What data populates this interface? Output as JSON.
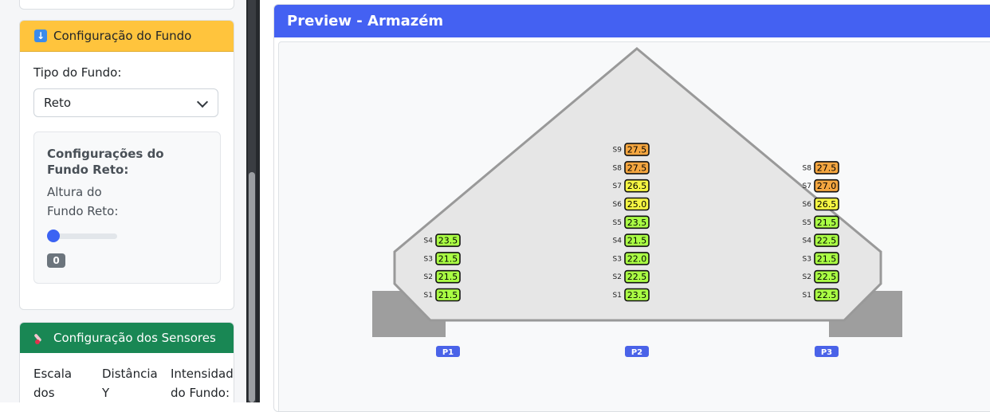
{
  "top_card": {},
  "fundo_card": {
    "title": "Configuração do Fundo",
    "tipo_label": "Tipo do Fundo:",
    "tipo_value": "Reto",
    "sub_title": "Configurações do Fundo Reto:",
    "altura_label": "Altura do Fundo Reto:",
    "altura_value": "0",
    "altura_fraction": 0
  },
  "sensores_card": {
    "title": "Configuração dos Sensores",
    "columns": [
      "Escala dos",
      "Distância Y",
      "Intensidade do Fundo:"
    ]
  },
  "preview": {
    "title": "Preview - Armazém",
    "pendulums": [
      {
        "label": "P1",
        "sensors": [
          {
            "name": "S1",
            "value": "21.5",
            "color": "#aaff44"
          },
          {
            "name": "S2",
            "value": "21.5",
            "color": "#aaff44"
          },
          {
            "name": "S3",
            "value": "21.5",
            "color": "#aaff44"
          },
          {
            "name": "S4",
            "value": "23.5",
            "color": "#aaff44"
          }
        ]
      },
      {
        "label": "P2",
        "sensors": [
          {
            "name": "S1",
            "value": "23.5",
            "color": "#aaff44"
          },
          {
            "name": "S2",
            "value": "22.5",
            "color": "#aaff44"
          },
          {
            "name": "S3",
            "value": "22.0",
            "color": "#aaff44"
          },
          {
            "name": "S4",
            "value": "21.5",
            "color": "#aaff44"
          },
          {
            "name": "S5",
            "value": "23.5",
            "color": "#aaff44"
          },
          {
            "name": "S6",
            "value": "25.0",
            "color": "#f5f542"
          },
          {
            "name": "S7",
            "value": "26.5",
            "color": "#f5f542"
          },
          {
            "name": "S8",
            "value": "27.5",
            "color": "#f4a640"
          },
          {
            "name": "S9",
            "value": "27.5",
            "color": "#f4a640"
          }
        ]
      },
      {
        "label": "P3",
        "sensors": [
          {
            "name": "S1",
            "value": "22.5",
            "color": "#aaff44"
          },
          {
            "name": "S2",
            "value": "22.5",
            "color": "#aaff44"
          },
          {
            "name": "S3",
            "value": "21.5",
            "color": "#aaff44"
          },
          {
            "name": "S4",
            "value": "22.5",
            "color": "#aaff44"
          },
          {
            "name": "S5",
            "value": "21.5",
            "color": "#aaff44"
          },
          {
            "name": "S6",
            "value": "26.5",
            "color": "#f5f542"
          },
          {
            "name": "S7",
            "value": "27.0",
            "color": "#f4a640"
          },
          {
            "name": "S8",
            "value": "27.5",
            "color": "#f4a640"
          }
        ]
      }
    ]
  },
  "colors": {
    "header_yellow": "#ffc43d",
    "header_green": "#198754",
    "header_blue": "#4461f2",
    "pendulum_badge": "#4a63e8"
  }
}
